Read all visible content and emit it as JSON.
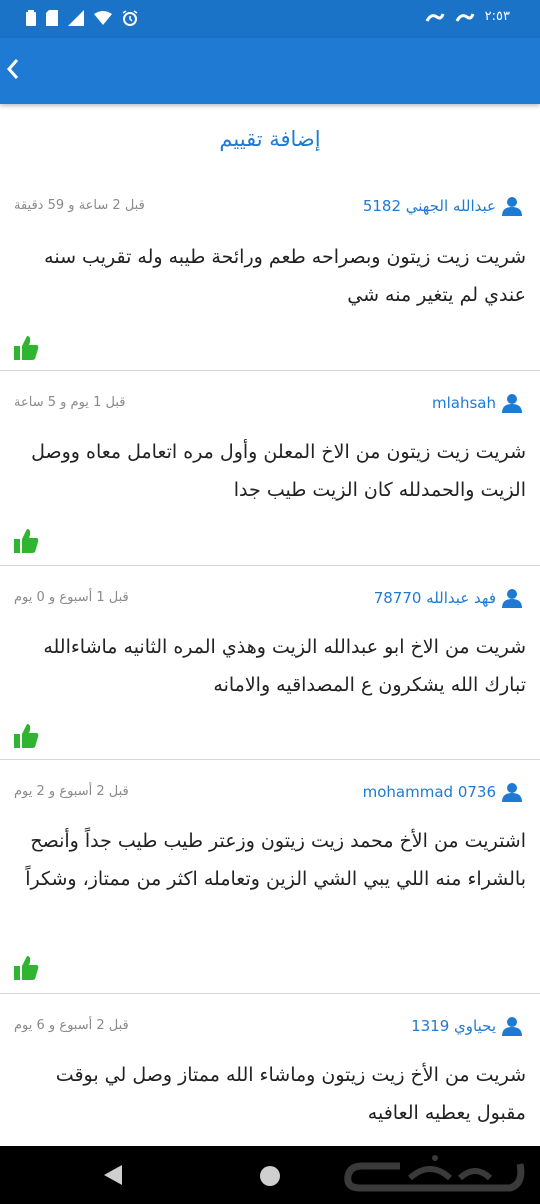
{
  "status_bar": {
    "time": "٢:٥٣",
    "icons": [
      "battery-icon",
      "sim-icon",
      "signal-icon",
      "wifi-icon",
      "alarm-icon",
      "app-notification-icon"
    ]
  },
  "app_bar": {
    "back_icon": "chevron-left-icon"
  },
  "add_review": {
    "label": "إضافة تقييم"
  },
  "colors": {
    "primary": "#1f7ad3",
    "like_green": "#2fb52f",
    "text": "#222222",
    "muted": "#8a8a8a"
  },
  "reviews": [
    {
      "user": "عبدالله الجهني 5182",
      "time": "قبل 2 ساعة و 59 دقيقة",
      "text": "شريت زيت زيتون وبصراحه طعم ورائحة طيبه وله تقريب سنه عندي لم يتغير منه شي"
    },
    {
      "user": "mlahsah",
      "time": "قبل 1 يوم و 5 ساعة",
      "text": "شريت زيت زيتون من الاخ المعلن وأول مره اتعامل معاه ووصل الزيت والحمدلله كان الزيت طيب جدا"
    },
    {
      "user": "فهد عبدالله 78770",
      "time": "قبل 1 أسبوع و 0 يوم",
      "text": "شريت من الاخ ابو عبدالله الزيت وهذي المره الثانيه ماشاءالله تبارك الله يشكرون ع المصداقيه والامانه"
    },
    {
      "user": "mohammad 0736",
      "time": "قبل 2 أسبوع و 2 يوم",
      "text": "اشتريت من الأخ محمد زيت زيتون وزعتر طيب طيب جداً وأنصح بالشراء منه اللي يبي الشي الزين وتعامله اكثر من ممتاز، وشكراً"
    },
    {
      "user": "يحياوي 1319",
      "time": "قبل 2 أسبوع و 6 يوم",
      "text": "شريت من الأخ زيت زيتون وماشاء الله ممتاز وصل لي بوقت مقبول يعطيه العافيه"
    }
  ],
  "nav_bar": {
    "icons": [
      "nav-back-icon",
      "nav-home-icon"
    ],
    "watermark": "حراج"
  }
}
